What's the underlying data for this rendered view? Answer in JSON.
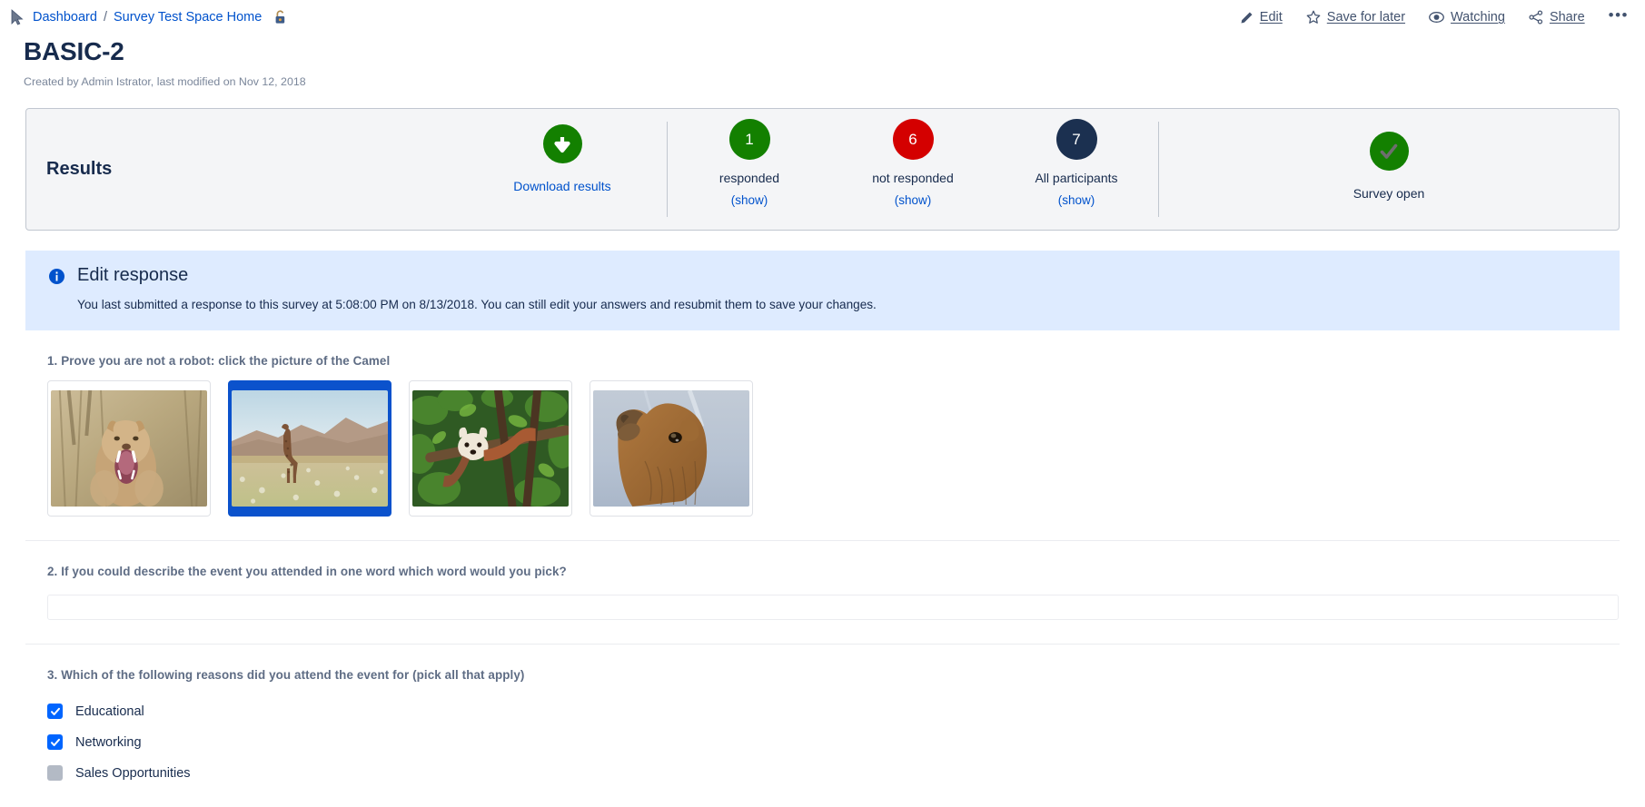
{
  "breadcrumb": {
    "items": [
      {
        "label": "Dashboard"
      },
      {
        "label": "Survey Test Space Home"
      }
    ],
    "separator": "/",
    "lock_icon": "unlocked-padlock-icon"
  },
  "top_actions": [
    {
      "icon": "pencil-icon",
      "label": "Edit"
    },
    {
      "icon": "star-icon",
      "label": "Save for later"
    },
    {
      "icon": "eye-icon",
      "label": "Watching"
    },
    {
      "icon": "share-icon",
      "label": "Share"
    },
    {
      "icon": "more-actions-icon",
      "label": "•••"
    }
  ],
  "page": {
    "title": "BASIC-2",
    "meta": "Created by Admin Istrator, last modified on Nov 12, 2018"
  },
  "results": {
    "heading": "Results",
    "download": {
      "icon": "download-arrow-icon",
      "label": "Download results",
      "color": "#138000"
    },
    "stats": [
      {
        "value": "1",
        "caption": "responded",
        "link": "(show)",
        "color": "#138000"
      },
      {
        "value": "6",
        "caption": "not responded",
        "link": "(show)",
        "color": "#D40000"
      },
      {
        "value": "7",
        "caption": "All participants",
        "link": "(show)",
        "color": "#1B3050"
      }
    ],
    "status": {
      "icon": "check-mark-icon",
      "caption": "Survey open",
      "color": "#138000"
    }
  },
  "banner": {
    "icon": "info-icon",
    "title": "Edit response",
    "body": "You last submitted a response to this survey at 5:08:00 PM on 8/13/2018. You can still edit your answers and resubmit them to save your changes.",
    "bg_color": "#DEEBFF",
    "icon_color": "#0052CC"
  },
  "questions": [
    {
      "type": "image-choice",
      "text": "1. Prove you are not a robot: click the picture of the Camel",
      "options": [
        {
          "name": "lion-photo",
          "selected": false
        },
        {
          "name": "giraffe-photo",
          "selected": true
        },
        {
          "name": "red-panda-photo",
          "selected": false
        },
        {
          "name": "camel-photo",
          "selected": false
        }
      ],
      "selected_color": "#0B52CC"
    },
    {
      "type": "text",
      "text": "2. If you could describe the event you attended in one word which word would you pick?",
      "value": "",
      "placeholder": ""
    },
    {
      "type": "checkbox",
      "text": "3. Which of the following reasons did you attend the event for (pick all that apply)",
      "options": [
        {
          "label": "Educational",
          "checked": true
        },
        {
          "label": "Networking",
          "checked": true
        },
        {
          "label": "Sales Opportunities",
          "checked": false
        }
      ],
      "checked_color": "#0065FF",
      "unchecked_color": "#B3BAC5"
    }
  ]
}
